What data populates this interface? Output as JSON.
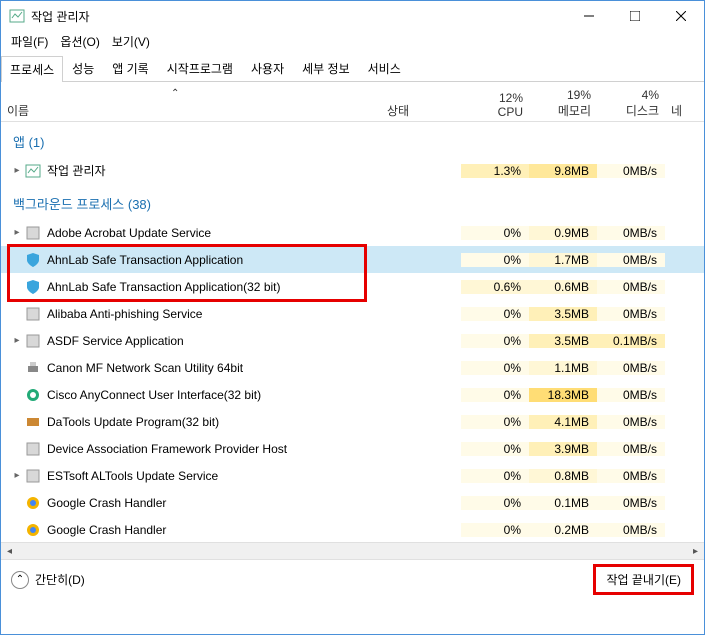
{
  "window": {
    "title": "작업 관리자"
  },
  "menu": {
    "file": "파일(F)",
    "options": "옵션(O)",
    "view": "보기(V)"
  },
  "tabs": [
    "프로세스",
    "성능",
    "앱 기록",
    "시작프로그램",
    "사용자",
    "세부 정보",
    "서비스"
  ],
  "headers": {
    "name": "이름",
    "status": "상태",
    "cpu_pct": "12%",
    "cpu": "CPU",
    "mem_pct": "19%",
    "mem": "메모리",
    "disk_pct": "4%",
    "disk": "디스크",
    "net": "네"
  },
  "groups": [
    {
      "title": "앱 (1)"
    },
    {
      "title": "백그라운드 프로세스 (38)"
    }
  ],
  "rows": {
    "apps": [
      {
        "name": "작업 관리자",
        "expand": true,
        "icon": "taskmgr",
        "cpu": "1.3%",
        "mem": "9.8MB",
        "disk": "0MB/s",
        "cpu_h": 2,
        "mem_h": 3,
        "disk_h": 0
      }
    ],
    "bg": [
      {
        "name": "Adobe Acrobat Update Service",
        "expand": true,
        "icon": "generic",
        "cpu": "0%",
        "mem": "0.9MB",
        "disk": "0MB/s",
        "cpu_h": 0,
        "mem_h": 1,
        "disk_h": 0
      },
      {
        "name": "AhnLab Safe Transaction Application",
        "expand": false,
        "icon": "shield",
        "cpu": "0%",
        "mem": "1.7MB",
        "disk": "0MB/s",
        "cpu_h": 0,
        "mem_h": 1,
        "disk_h": 0,
        "selected": true
      },
      {
        "name": "AhnLab Safe Transaction Application(32 bit)",
        "expand": false,
        "icon": "shield",
        "cpu": "0.6%",
        "mem": "0.6MB",
        "disk": "0MB/s",
        "cpu_h": 1,
        "mem_h": 1,
        "disk_h": 0
      },
      {
        "name": "Alibaba Anti-phishing Service",
        "expand": false,
        "icon": "generic",
        "cpu": "0%",
        "mem": "3.5MB",
        "disk": "0MB/s",
        "cpu_h": 0,
        "mem_h": 2,
        "disk_h": 0
      },
      {
        "name": "ASDF Service Application",
        "expand": true,
        "icon": "generic",
        "cpu": "0%",
        "mem": "3.5MB",
        "disk": "0.1MB/s",
        "cpu_h": 0,
        "mem_h": 2,
        "disk_h": 2
      },
      {
        "name": "Canon MF Network Scan Utility 64bit",
        "expand": false,
        "icon": "printer",
        "cpu": "0%",
        "mem": "1.1MB",
        "disk": "0MB/s",
        "cpu_h": 0,
        "mem_h": 1,
        "disk_h": 0
      },
      {
        "name": "Cisco AnyConnect User Interface(32 bit)",
        "expand": false,
        "icon": "cisco",
        "cpu": "0%",
        "mem": "18.3MB",
        "disk": "0MB/s",
        "cpu_h": 0,
        "mem_h": 4,
        "disk_h": 0
      },
      {
        "name": "DaTools Update Program(32 bit)",
        "expand": false,
        "icon": "tools",
        "cpu": "0%",
        "mem": "4.1MB",
        "disk": "0MB/s",
        "cpu_h": 0,
        "mem_h": 2,
        "disk_h": 0
      },
      {
        "name": "Device Association Framework Provider Host",
        "expand": false,
        "icon": "generic",
        "cpu": "0%",
        "mem": "3.9MB",
        "disk": "0MB/s",
        "cpu_h": 0,
        "mem_h": 2,
        "disk_h": 0
      },
      {
        "name": "ESTsoft ALTools Update Service",
        "expand": true,
        "icon": "generic",
        "cpu": "0%",
        "mem": "0.8MB",
        "disk": "0MB/s",
        "cpu_h": 0,
        "mem_h": 1,
        "disk_h": 0
      },
      {
        "name": "Google Crash Handler",
        "expand": false,
        "icon": "google",
        "cpu": "0%",
        "mem": "0.1MB",
        "disk": "0MB/s",
        "cpu_h": 0,
        "mem_h": 0,
        "disk_h": 0
      },
      {
        "name": "Google Crash Handler",
        "expand": false,
        "icon": "google",
        "cpu": "0%",
        "mem": "0.2MB",
        "disk": "0MB/s",
        "cpu_h": 0,
        "mem_h": 0,
        "disk_h": 0
      }
    ]
  },
  "footer": {
    "less": "간단히(D)",
    "end": "작업 끝내기(E)"
  },
  "chart_data": {
    "type": "table",
    "title": "작업 관리자 — 프로세스",
    "columns": [
      "이름",
      "CPU",
      "메모리",
      "디스크"
    ],
    "column_totals": {
      "CPU": "12%",
      "메모리": "19%",
      "디스크": "4%"
    },
    "rows": [
      [
        "작업 관리자",
        "1.3%",
        "9.8MB",
        "0MB/s"
      ],
      [
        "Adobe Acrobat Update Service",
        "0%",
        "0.9MB",
        "0MB/s"
      ],
      [
        "AhnLab Safe Transaction Application",
        "0%",
        "1.7MB",
        "0MB/s"
      ],
      [
        "AhnLab Safe Transaction Application(32 bit)",
        "0.6%",
        "0.6MB",
        "0MB/s"
      ],
      [
        "Alibaba Anti-phishing Service",
        "0%",
        "3.5MB",
        "0MB/s"
      ],
      [
        "ASDF Service Application",
        "0%",
        "3.5MB",
        "0.1MB/s"
      ],
      [
        "Canon MF Network Scan Utility 64bit",
        "0%",
        "1.1MB",
        "0MB/s"
      ],
      [
        "Cisco AnyConnect User Interface(32 bit)",
        "0%",
        "18.3MB",
        "0MB/s"
      ],
      [
        "DaTools Update Program(32 bit)",
        "0%",
        "4.1MB",
        "0MB/s"
      ],
      [
        "Device Association Framework Provider Host",
        "0%",
        "3.9MB",
        "0MB/s"
      ],
      [
        "ESTsoft ALTools Update Service",
        "0%",
        "0.8MB",
        "0MB/s"
      ],
      [
        "Google Crash Handler",
        "0%",
        "0.1MB",
        "0MB/s"
      ],
      [
        "Google Crash Handler",
        "0%",
        "0.2MB",
        "0MB/s"
      ]
    ]
  }
}
